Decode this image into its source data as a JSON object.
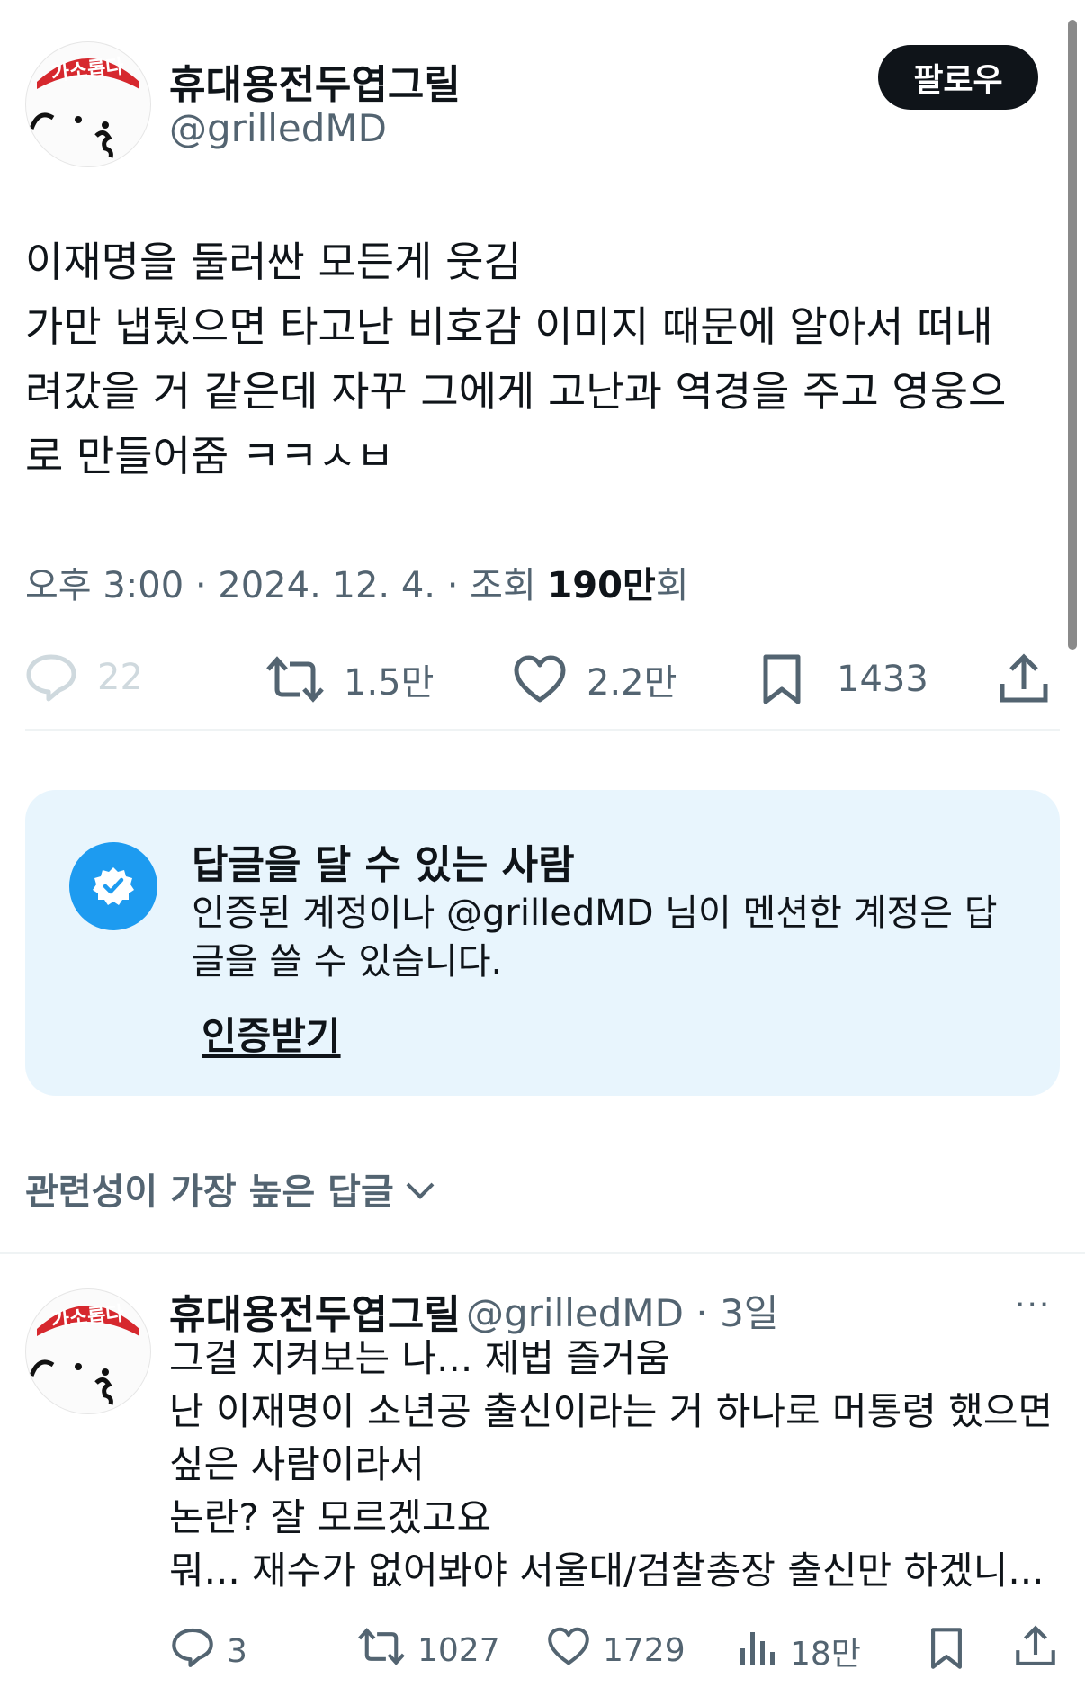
{
  "tweet": {
    "author_name": "휴대용전두엽그릴",
    "author_handle": "@grilledMD",
    "avatar_text": "가소롭다",
    "follow_label": "팔로우",
    "lines": [
      "이재명을 둘러싼 모든게 웃김",
      "가만 냅뒀으면 타고난 비호감 이미지 때문에 알아서 떠내",
      "려갔을 거 같은데 자꾸 그에게 고난과 역경을 주고 영웅으",
      "로 만들어줌 ㅋㅋㅅㅂ"
    ],
    "meta_prefix": "오후 3:00 · 2024. 12. 4. · 조회 ",
    "views_bold": "190만",
    "views_suffix": "회",
    "actions": {
      "reply_count": "22",
      "retweet_count": "1.5만",
      "like_count": "2.2만",
      "bookmark_count": "1433"
    }
  },
  "reply_restriction": {
    "title": "답글을 달 수 있는 사람",
    "desc_lines": [
      "인증된 계정이나 @grilledMD 님이 멘션한 계정은 답",
      "글을 쓸 수 있습니다."
    ],
    "link_label": "인증받기"
  },
  "sort": {
    "label": "관련성이 가장 높은 답글"
  },
  "reply": {
    "author_name": "휴대용전두엽그릴",
    "handle_time": "@grilledMD · 3일",
    "more": "···",
    "lines": [
      "그걸 지켜보는 나... 제법 즐거움",
      "난 이재명이 소년공 출신이라는 거 하나로 머통령 했으면",
      "싶은 사람이라서",
      "논란? 잘 모르겠고요",
      "뭐... 재수가 없어봐야 서울대/검찰총장 출신만 하겠니..."
    ],
    "actions": {
      "reply_count": "3",
      "retweet_count": "1027",
      "like_count": "1729",
      "views_count": "18만"
    }
  },
  "colors": {
    "text": "#0f1419",
    "secondary": "#536471",
    "accent": "#1d9bf0",
    "reply_box_bg": "#e8f5fd",
    "avatar_band": "#d6282e"
  },
  "icons": [
    "reply-icon",
    "retweet-icon",
    "like-icon",
    "bookmark-icon",
    "share-icon",
    "verified-icon",
    "chevron-down-icon",
    "views-icon",
    "more-icon"
  ]
}
